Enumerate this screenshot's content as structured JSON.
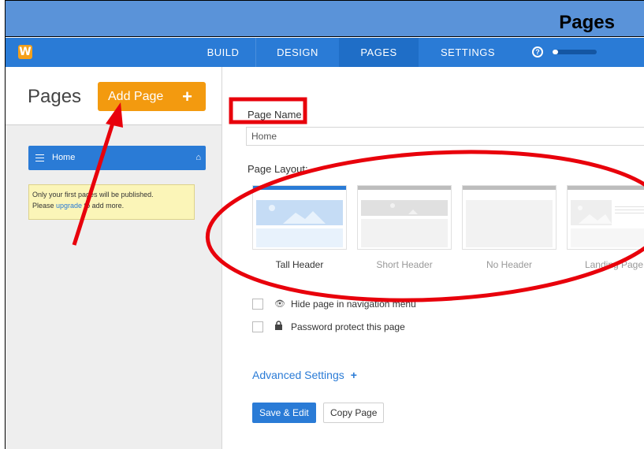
{
  "banner": {
    "title": "Pages"
  },
  "nav": {
    "logo": "W",
    "items": [
      "BUILD",
      "DESIGN",
      "PAGES",
      "SETTINGS"
    ],
    "help": "?",
    "progress": 0.12
  },
  "sidebar": {
    "title": "Pages",
    "add_button": "Add Page",
    "add_plus": "+",
    "home_item": "Home",
    "notice_before": "Only your first ",
    "notice_mid": " pages will be published.",
    "notice_line2_before": "Please ",
    "notice_link": "upgrade",
    "notice_line2_after": " to add more."
  },
  "main": {
    "page_name_label": "Page Name",
    "page_name_value": "Home",
    "page_layout_label": "Page Layout:",
    "layouts": [
      "Tall Header",
      "Short Header",
      "No Header",
      "Landing Page"
    ],
    "hide_nav_label": "Hide page in navigation menu",
    "password_label": "Password protect this page",
    "advanced_label": "Advanced Settings",
    "advanced_plus": "+",
    "save_button": "Save & Edit",
    "copy_button": "Copy Page"
  },
  "colors": {
    "banner": "#5a93d9",
    "nav": "#2a7bd6",
    "accent_orange": "#f39a0f",
    "annotation_red": "#e8000b"
  }
}
